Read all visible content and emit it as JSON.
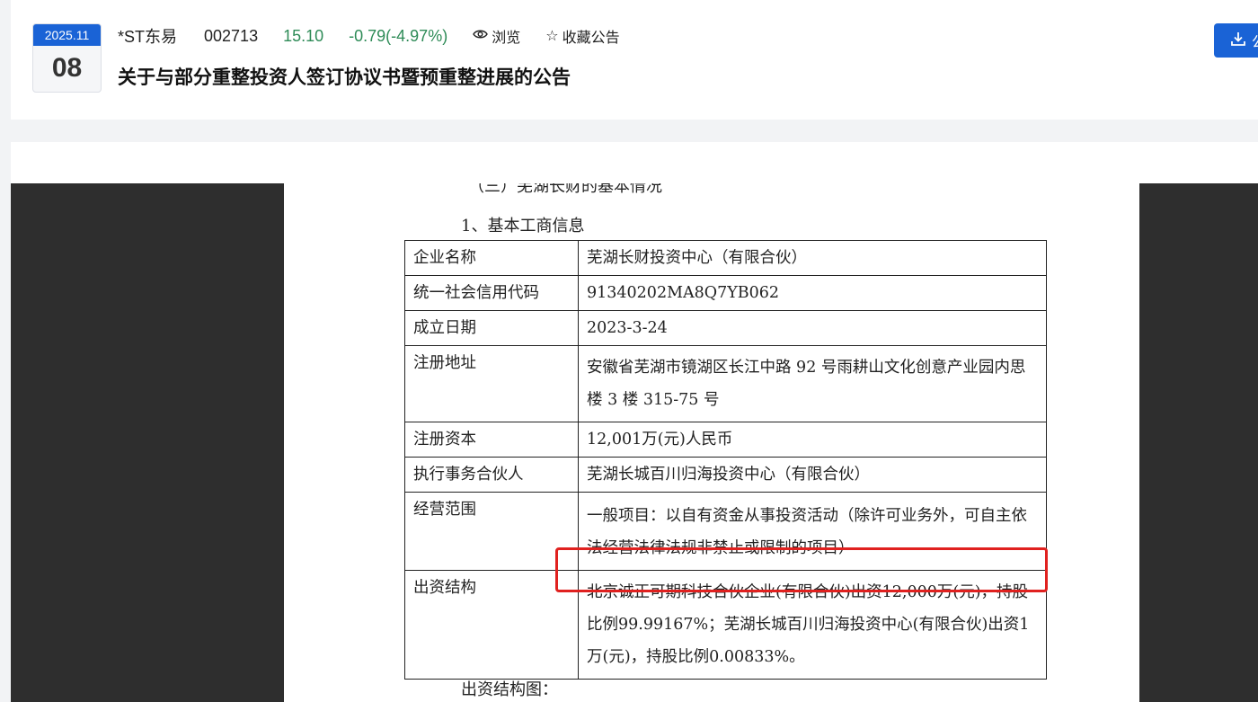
{
  "header": {
    "date_ym": "2025.11",
    "date_day": "08",
    "stock_name": "*ST东易",
    "stock_code": "002713",
    "price": "15.10",
    "change": "-0.79(-4.97%)",
    "browse_label": "浏览",
    "favorite_label": "收藏公告",
    "title": "关于与部分重整投资人签订协议书暨预重整进展的公告",
    "download_label": "公"
  },
  "doc": {
    "section_heading": "（三）芜湖长财的基本情况",
    "sub_heading": "1、基本工商信息",
    "rows": [
      {
        "key": "企业名称",
        "value": "芜湖长财投资中心（有限合伙）"
      },
      {
        "key": "统一社会信用代码",
        "value": "91340202MA8Q7YB062"
      },
      {
        "key": "成立日期",
        "value": "2023-3-24"
      },
      {
        "key": "注册地址",
        "value": "安徽省芜湖市镜湖区长江中路 92 号雨耕山文化创意产业园内思楼 3 楼 315-75 号"
      },
      {
        "key": "注册资本",
        "value": "12,001万(元)人民币"
      },
      {
        "key": "执行事务合伙人",
        "value": "芜湖长城百川归海投资中心（有限合伙）"
      },
      {
        "key": "经营范围",
        "value": "一般项目：以自有资金从事投资活动（除许可业务外，可自主依法经营法律法规非禁止或限制的项目）"
      },
      {
        "key": "出资结构",
        "value": "北京诚正可期科技合伙企业(有限合伙)出资12,000万(元)，持股比例99.99167%；芜湖长城百川归海投资中心(有限合伙)出资1万(元)，持股比例0.00833%。"
      }
    ],
    "footer_line": "出资结构图："
  },
  "colors": {
    "accent_blue": "#1a63d6",
    "price_green": "#2e8b57",
    "highlight_red": "#e0211f"
  }
}
